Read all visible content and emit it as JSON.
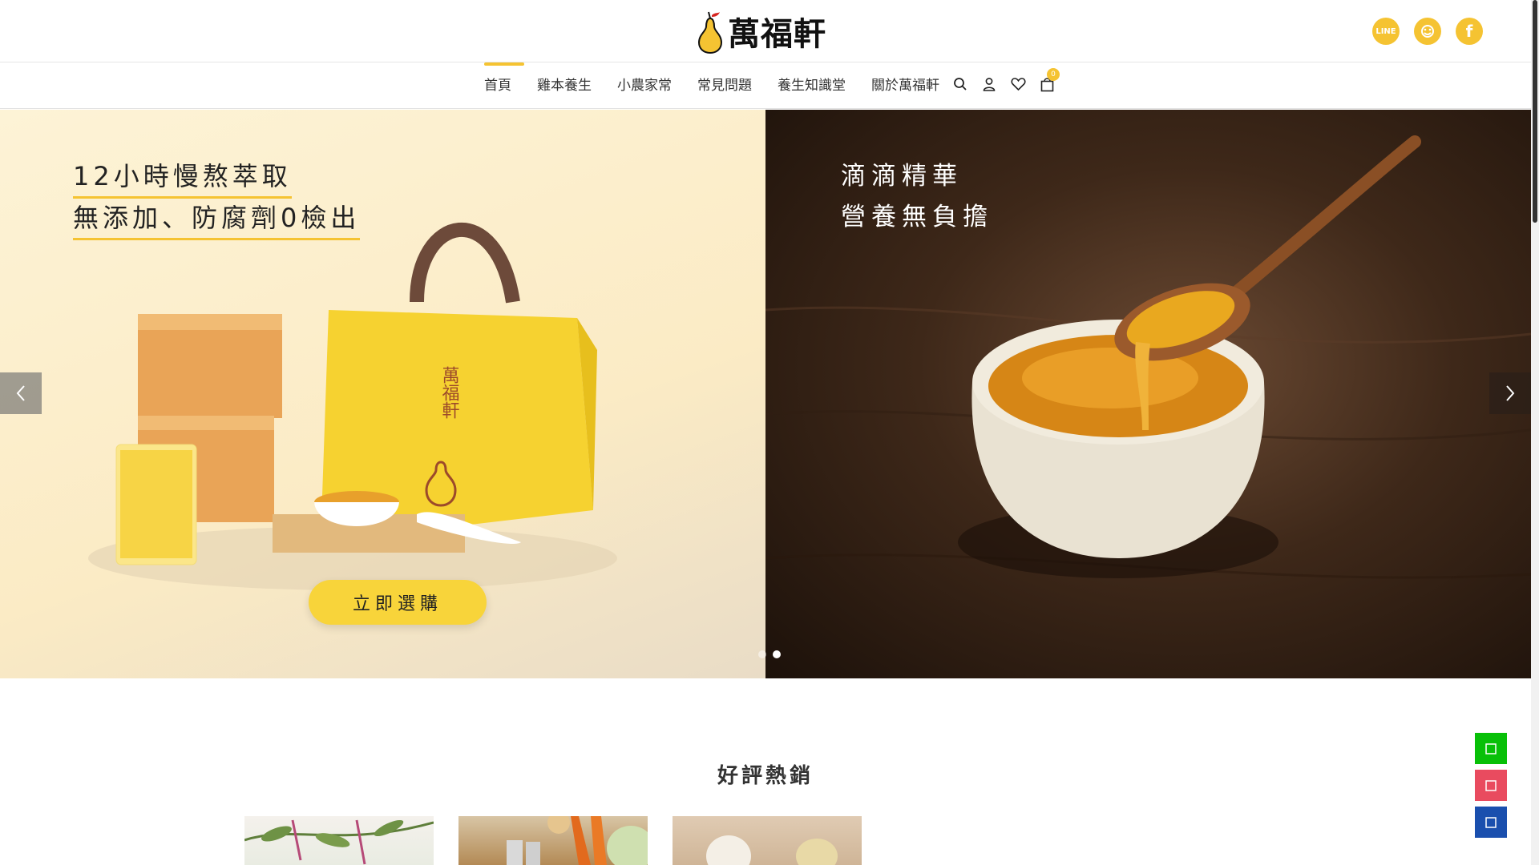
{
  "brand": {
    "name": "萬福軒",
    "accent": "#f5c332"
  },
  "social": [
    {
      "icon": "line-icon",
      "label": "LINE"
    },
    {
      "icon": "smile-icon",
      "label": ""
    },
    {
      "icon": "facebook-icon",
      "label": "f"
    }
  ],
  "nav": {
    "items": [
      {
        "label": "首頁",
        "active": true
      },
      {
        "label": "雞本養生"
      },
      {
        "label": "小農家常"
      },
      {
        "label": "常見問題"
      },
      {
        "label": "養生知識堂"
      },
      {
        "label": "關於萬福軒"
      }
    ],
    "icons": [
      "search-icon",
      "user-icon",
      "heart-icon",
      "cart-icon"
    ],
    "cart_count": "0"
  },
  "hero": {
    "left": {
      "line1": "12小時慢熬萃取",
      "line2": "無添加、防腐劑0檢出",
      "cta": "立即選購",
      "bag_text": "萬福軒"
    },
    "right": {
      "line1": "滴滴精華",
      "line2": "營養無負擔"
    },
    "active_slide": 2,
    "slide_count": 2
  },
  "section": {
    "title": "好評熱銷"
  },
  "float_buttons": [
    {
      "icon": "line-icon",
      "color": "#08c008"
    },
    {
      "icon": "instagram-icon",
      "color": "#e94b5f"
    },
    {
      "icon": "facebook-icon",
      "color": "#1a4fae"
    }
  ]
}
